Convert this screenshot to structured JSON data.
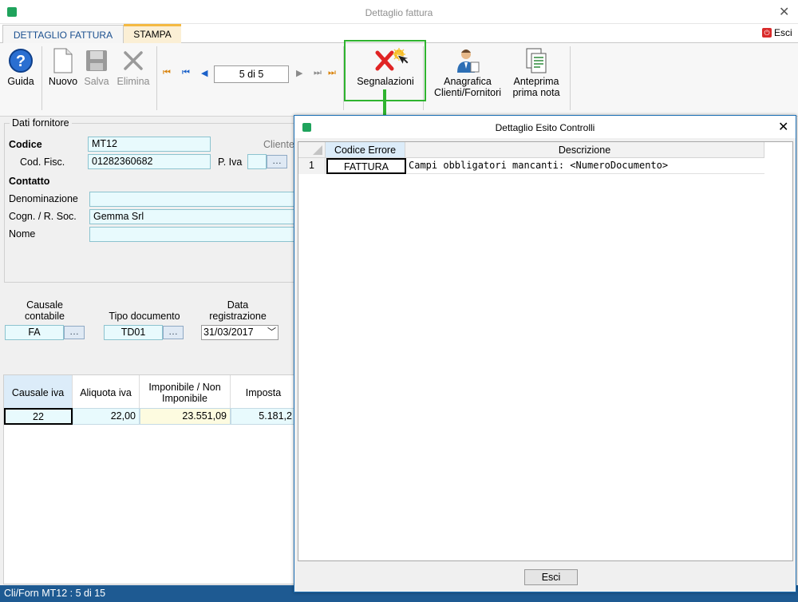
{
  "window": {
    "title": "Dettaglio fattura",
    "close_glyph": "✕"
  },
  "tabs": [
    {
      "label": "DETTAGLIO FATTURA"
    },
    {
      "label": "STAMPA"
    }
  ],
  "esci_top": {
    "label": "Esci",
    "icon": "power-icon"
  },
  "toolbar": {
    "guida": "Guida",
    "nuovo": "Nuovo",
    "salva": "Salva",
    "elimina": "Elimina",
    "record_position": "5 di 5",
    "segnalazioni": "Segnalazioni",
    "anagrafica_line1": "Anagrafica",
    "anagrafica_line2": "Clienti/Fornitori",
    "anteprima_line1": "Anteprima",
    "anteprima_line2": "prima nota"
  },
  "fornitore": {
    "section_title": "Dati fornitore",
    "codice_label": "Codice",
    "codice_value": "MT12",
    "cliente_label": "Cliente",
    "codfisc_label": "Cod. Fisc.",
    "codfisc_value": "01282360682",
    "piva_label": "P. Iva",
    "piva_value": "",
    "contatto_label": "Contatto",
    "denominazione_label": "Denominazione",
    "denominazione_value": "",
    "cognome_label": "Cogn. / R. Soc.",
    "cognome_value": "Gemma Srl",
    "nome_label": "Nome",
    "nome_value": ""
  },
  "documento": {
    "causale_label_1": "Causale",
    "causale_label_2": "contabile",
    "causale_value": "FA",
    "tipo_label": "Tipo documento",
    "tipo_value": "TD01",
    "data_label_1": "Data",
    "data_label_2": "registrazione",
    "data_value": "31/03/2017"
  },
  "iva_grid": {
    "headers": [
      "Causale iva",
      "Aliquota iva",
      "Imponibile / Non Imponibile",
      "Imposta"
    ],
    "row": [
      "22",
      "22,00",
      "23.551,09",
      "5.181,2"
    ]
  },
  "statusbar": {
    "text": "Cli/Forn MT12 : 5 di 15"
  },
  "dialog": {
    "title": "Dettaglio Esito Controlli",
    "close_glyph": "✕",
    "headers": {
      "codice": "Codice Errore",
      "descrizione": "Descrizione"
    },
    "rows": [
      {
        "num": "1",
        "codice": "FATTURA",
        "descrizione": "Campi obbligatori mancanti: <NumeroDocumento>"
      }
    ],
    "esci": "Esci"
  },
  "colors": {
    "accent_blue": "#1e5a92",
    "highlight_green": "#2fb32f",
    "field_bg": "#e8fafd",
    "stampa_tab": "#f4b942"
  }
}
